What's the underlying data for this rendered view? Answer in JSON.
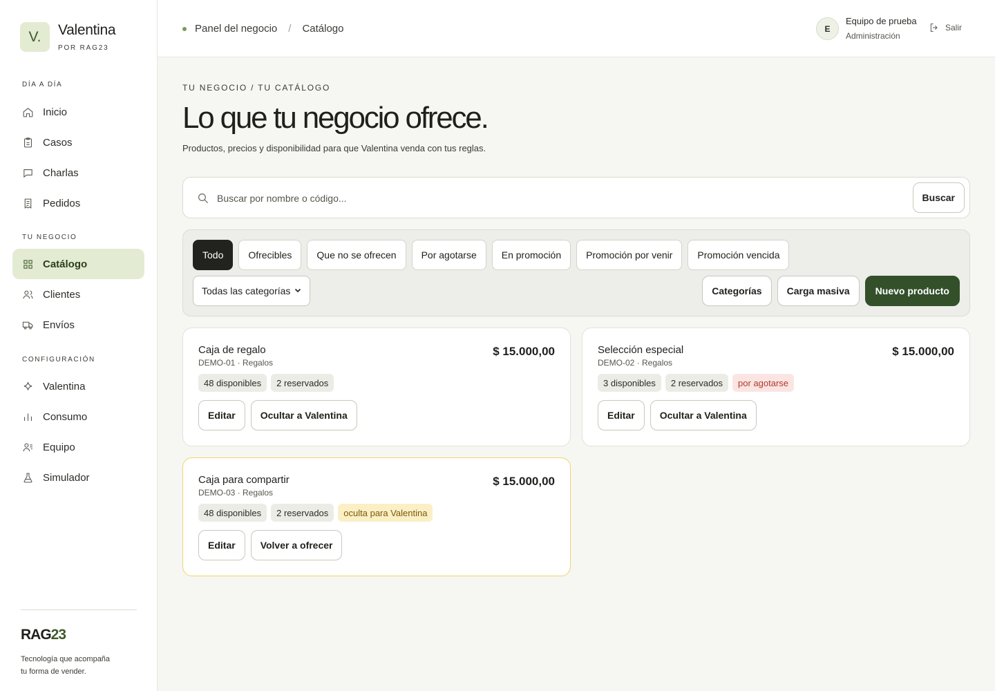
{
  "brand": {
    "mark": "V.",
    "name": "Valentina",
    "sub": "POR RAG23"
  },
  "sidebar": {
    "sections": [
      {
        "heading": "DÍA A DÍA",
        "items": [
          {
            "label": "Inicio",
            "icon": "home-icon"
          },
          {
            "label": "Casos",
            "icon": "clipboard-icon"
          },
          {
            "label": "Charlas",
            "icon": "chat-icon"
          },
          {
            "label": "Pedidos",
            "icon": "receipt-icon"
          }
        ]
      },
      {
        "heading": "TU NEGOCIO",
        "items": [
          {
            "label": "Catálogo",
            "icon": "grid-icon",
            "active": true
          },
          {
            "label": "Clientes",
            "icon": "users-icon"
          },
          {
            "label": "Envíos",
            "icon": "truck-icon"
          }
        ]
      },
      {
        "heading": "CONFIGURACIÓN",
        "items": [
          {
            "label": "Valentina",
            "icon": "sparkle-icon"
          },
          {
            "label": "Consumo",
            "icon": "bar-chart-icon"
          },
          {
            "label": "Equipo",
            "icon": "team-icon"
          },
          {
            "label": "Simulador",
            "icon": "flask-icon"
          }
        ]
      }
    ],
    "footer": {
      "logo_a": "RAG",
      "logo_b": "23",
      "tagline": "Tecnología que acompaña tu forma de vender."
    }
  },
  "topbar": {
    "breadcrumb": [
      "Panel del negocio",
      "Catálogo"
    ],
    "breadcrumb_sep": "/",
    "user": {
      "initial": "E",
      "name": "Equipo de prueba",
      "role": "Administración"
    },
    "logout_label": "Salir"
  },
  "page": {
    "eyebrow": "TU NEGOCIO / TU CATÁLOGO",
    "title": "Lo que tu negocio ofrece.",
    "subtitle": "Productos, precios y disponibilidad para que Valentina venda con tus reglas."
  },
  "search": {
    "placeholder": "Buscar por nombre o código...",
    "value": "",
    "button": "Buscar"
  },
  "filters": {
    "chips": [
      {
        "label": "Todo",
        "active": true
      },
      {
        "label": "Ofrecibles"
      },
      {
        "label": "Que no se ofrecen"
      },
      {
        "label": "Por agotarse"
      },
      {
        "label": "En promoción"
      },
      {
        "label": "Promoción por venir"
      },
      {
        "label": "Promoción vencida"
      }
    ],
    "category_select": "Todas las categorías",
    "categories_button": "Categorías",
    "bulk_button": "Carga masiva",
    "new_button": "Nuevo producto"
  },
  "products": [
    {
      "name": "Caja de regalo",
      "meta": "DEMO-01 · Regalos",
      "price": "$ 15.000,00",
      "tags": [
        {
          "label": "48 disponibles",
          "kind": "neutral"
        },
        {
          "label": "2 reservados",
          "kind": "neutral"
        }
      ],
      "actions": [
        "Editar",
        "Ocultar a Valentina"
      ],
      "hidden": false
    },
    {
      "name": "Selección especial",
      "meta": "DEMO-02 · Regalos",
      "price": "$ 15.000,00",
      "tags": [
        {
          "label": "3 disponibles",
          "kind": "neutral"
        },
        {
          "label": "2 reservados",
          "kind": "neutral"
        },
        {
          "label": "por agotarse",
          "kind": "warn"
        }
      ],
      "actions": [
        "Editar",
        "Ocultar a Valentina"
      ],
      "hidden": false
    },
    {
      "name": "Caja para compartir",
      "meta": "DEMO-03 · Regalos",
      "price": "$ 15.000,00",
      "tags": [
        {
          "label": "48 disponibles",
          "kind": "neutral"
        },
        {
          "label": "2 reservados",
          "kind": "neutral"
        },
        {
          "label": "oculta para Valentina",
          "kind": "hidden"
        }
      ],
      "actions": [
        "Editar",
        "Volver a ofrecer"
      ],
      "hidden": true
    }
  ],
  "colors": {
    "accent": "#33502a",
    "accent_soft": "#e3ebd3",
    "warn": "#b03a2e",
    "hidden_border": "#f0d46a"
  }
}
